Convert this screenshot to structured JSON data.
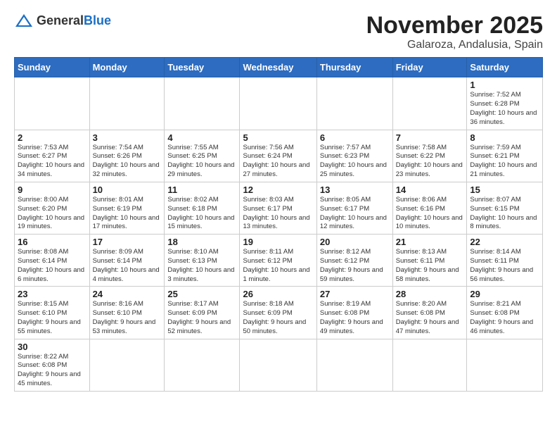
{
  "logo": {
    "text_general": "General",
    "text_blue": "Blue"
  },
  "title": {
    "month_year": "November 2025",
    "location": "Galaroza, Andalusia, Spain"
  },
  "weekdays": [
    "Sunday",
    "Monday",
    "Tuesday",
    "Wednesday",
    "Thursday",
    "Friday",
    "Saturday"
  ],
  "weeks": [
    [
      {
        "day": "",
        "info": ""
      },
      {
        "day": "",
        "info": ""
      },
      {
        "day": "",
        "info": ""
      },
      {
        "day": "",
        "info": ""
      },
      {
        "day": "",
        "info": ""
      },
      {
        "day": "",
        "info": ""
      },
      {
        "day": "1",
        "info": "Sunrise: 7:52 AM\nSunset: 6:28 PM\nDaylight: 10 hours and 36 minutes."
      }
    ],
    [
      {
        "day": "2",
        "info": "Sunrise: 7:53 AM\nSunset: 6:27 PM\nDaylight: 10 hours and 34 minutes."
      },
      {
        "day": "3",
        "info": "Sunrise: 7:54 AM\nSunset: 6:26 PM\nDaylight: 10 hours and 32 minutes."
      },
      {
        "day": "4",
        "info": "Sunrise: 7:55 AM\nSunset: 6:25 PM\nDaylight: 10 hours and 29 minutes."
      },
      {
        "day": "5",
        "info": "Sunrise: 7:56 AM\nSunset: 6:24 PM\nDaylight: 10 hours and 27 minutes."
      },
      {
        "day": "6",
        "info": "Sunrise: 7:57 AM\nSunset: 6:23 PM\nDaylight: 10 hours and 25 minutes."
      },
      {
        "day": "7",
        "info": "Sunrise: 7:58 AM\nSunset: 6:22 PM\nDaylight: 10 hours and 23 minutes."
      },
      {
        "day": "8",
        "info": "Sunrise: 7:59 AM\nSunset: 6:21 PM\nDaylight: 10 hours and 21 minutes."
      }
    ],
    [
      {
        "day": "9",
        "info": "Sunrise: 8:00 AM\nSunset: 6:20 PM\nDaylight: 10 hours and 19 minutes."
      },
      {
        "day": "10",
        "info": "Sunrise: 8:01 AM\nSunset: 6:19 PM\nDaylight: 10 hours and 17 minutes."
      },
      {
        "day": "11",
        "info": "Sunrise: 8:02 AM\nSunset: 6:18 PM\nDaylight: 10 hours and 15 minutes."
      },
      {
        "day": "12",
        "info": "Sunrise: 8:03 AM\nSunset: 6:17 PM\nDaylight: 10 hours and 13 minutes."
      },
      {
        "day": "13",
        "info": "Sunrise: 8:05 AM\nSunset: 6:17 PM\nDaylight: 10 hours and 12 minutes."
      },
      {
        "day": "14",
        "info": "Sunrise: 8:06 AM\nSunset: 6:16 PM\nDaylight: 10 hours and 10 minutes."
      },
      {
        "day": "15",
        "info": "Sunrise: 8:07 AM\nSunset: 6:15 PM\nDaylight: 10 hours and 8 minutes."
      }
    ],
    [
      {
        "day": "16",
        "info": "Sunrise: 8:08 AM\nSunset: 6:14 PM\nDaylight: 10 hours and 6 minutes."
      },
      {
        "day": "17",
        "info": "Sunrise: 8:09 AM\nSunset: 6:14 PM\nDaylight: 10 hours and 4 minutes."
      },
      {
        "day": "18",
        "info": "Sunrise: 8:10 AM\nSunset: 6:13 PM\nDaylight: 10 hours and 3 minutes."
      },
      {
        "day": "19",
        "info": "Sunrise: 8:11 AM\nSunset: 6:12 PM\nDaylight: 10 hours and 1 minute."
      },
      {
        "day": "20",
        "info": "Sunrise: 8:12 AM\nSunset: 6:12 PM\nDaylight: 9 hours and 59 minutes."
      },
      {
        "day": "21",
        "info": "Sunrise: 8:13 AM\nSunset: 6:11 PM\nDaylight: 9 hours and 58 minutes."
      },
      {
        "day": "22",
        "info": "Sunrise: 8:14 AM\nSunset: 6:11 PM\nDaylight: 9 hours and 56 minutes."
      }
    ],
    [
      {
        "day": "23",
        "info": "Sunrise: 8:15 AM\nSunset: 6:10 PM\nDaylight: 9 hours and 55 minutes."
      },
      {
        "day": "24",
        "info": "Sunrise: 8:16 AM\nSunset: 6:10 PM\nDaylight: 9 hours and 53 minutes."
      },
      {
        "day": "25",
        "info": "Sunrise: 8:17 AM\nSunset: 6:09 PM\nDaylight: 9 hours and 52 minutes."
      },
      {
        "day": "26",
        "info": "Sunrise: 8:18 AM\nSunset: 6:09 PM\nDaylight: 9 hours and 50 minutes."
      },
      {
        "day": "27",
        "info": "Sunrise: 8:19 AM\nSunset: 6:08 PM\nDaylight: 9 hours and 49 minutes."
      },
      {
        "day": "28",
        "info": "Sunrise: 8:20 AM\nSunset: 6:08 PM\nDaylight: 9 hours and 47 minutes."
      },
      {
        "day": "29",
        "info": "Sunrise: 8:21 AM\nSunset: 6:08 PM\nDaylight: 9 hours and 46 minutes."
      }
    ],
    [
      {
        "day": "30",
        "info": "Sunrise: 8:22 AM\nSunset: 6:08 PM\nDaylight: 9 hours and 45 minutes."
      },
      {
        "day": "",
        "info": ""
      },
      {
        "day": "",
        "info": ""
      },
      {
        "day": "",
        "info": ""
      },
      {
        "day": "",
        "info": ""
      },
      {
        "day": "",
        "info": ""
      },
      {
        "day": "",
        "info": ""
      }
    ]
  ]
}
